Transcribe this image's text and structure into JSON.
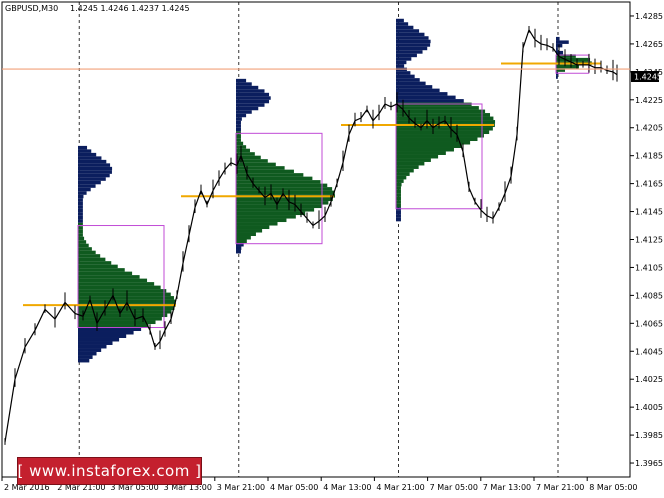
{
  "chart_data": {
    "type": "candlestick",
    "symbol_header": "GBPUSD,M30",
    "ohlc_header": "1.4245 1.4246 1.4237 1.4245",
    "current_price_label": "1.4245",
    "ylim": [
      1.3955,
      1.4295
    ],
    "y_ticks": [
      "1.4285",
      "1.4265",
      "1.4245",
      "1.4225",
      "1.4205",
      "1.4185",
      "1.4165",
      "1.4145",
      "1.4125",
      "1.4105",
      "1.4085",
      "1.4065",
      "1.4045",
      "1.4025",
      "1.4005",
      "1.3985",
      "1.3965"
    ],
    "x_ticks": [
      "2 Mar 2016",
      "2 Mar 21:00",
      "3 Mar 05:00",
      "3 Mar 13:00",
      "3 Mar 21:00",
      "4 Mar 05:00",
      "4 Mar 13:00",
      "4 Mar 21:00",
      "7 Mar 05:00",
      "7 Mar 13:00",
      "7 Mar 21:00",
      "8 Mar 05:00"
    ],
    "session_separators": [
      "2 Mar 21:00",
      "3 Mar 21:00",
      "4 Mar 21:00",
      "7 Mar 21:00"
    ],
    "horizontal_level": 1.4247,
    "price_path": [
      [
        0,
        1.398
      ],
      [
        10,
        1.4025
      ],
      [
        20,
        1.4048
      ],
      [
        30,
        1.406
      ],
      [
        40,
        1.4075
      ],
      [
        50,
        1.4068
      ],
      [
        60,
        1.408
      ],
      [
        70,
        1.4072
      ],
      [
        78,
        1.407
      ],
      [
        85,
        1.4082
      ],
      [
        92,
        1.4065
      ],
      [
        100,
        1.4075
      ],
      [
        108,
        1.4085
      ],
      [
        115,
        1.4072
      ],
      [
        122,
        1.408
      ],
      [
        130,
        1.4068
      ],
      [
        138,
        1.407
      ],
      [
        145,
        1.406
      ],
      [
        150,
        1.4048
      ],
      [
        155,
        1.4052
      ],
      [
        160,
        1.406
      ],
      [
        166,
        1.4068
      ],
      [
        172,
        1.4085
      ],
      [
        178,
        1.4108
      ],
      [
        184,
        1.4128
      ],
      [
        190,
        1.4148
      ],
      [
        196,
        1.416
      ],
      [
        202,
        1.415
      ],
      [
        208,
        1.416
      ],
      [
        214,
        1.4168
      ],
      [
        220,
        1.4175
      ],
      [
        226,
        1.418
      ],
      [
        232,
        1.4178
      ],
      [
        236,
        1.4185
      ],
      [
        242,
        1.4172
      ],
      [
        248,
        1.4165
      ],
      [
        254,
        1.416
      ],
      [
        260,
        1.4155
      ],
      [
        266,
        1.4158
      ],
      [
        272,
        1.415
      ],
      [
        278,
        1.4158
      ],
      [
        284,
        1.4152
      ],
      [
        290,
        1.415
      ],
      [
        296,
        1.4145
      ],
      [
        302,
        1.414
      ],
      [
        308,
        1.4135
      ],
      [
        314,
        1.4138
      ],
      [
        320,
        1.4142
      ],
      [
        326,
        1.4152
      ],
      [
        332,
        1.4165
      ],
      [
        338,
        1.418
      ],
      [
        344,
        1.42
      ],
      [
        350,
        1.421
      ],
      [
        356,
        1.4212
      ],
      [
        362,
        1.4218
      ],
      [
        368,
        1.421
      ],
      [
        374,
        1.4215
      ],
      [
        380,
        1.4222
      ],
      [
        386,
        1.422
      ],
      [
        392,
        1.4222
      ],
      [
        398,
        1.4218
      ],
      [
        404,
        1.4212
      ],
      [
        410,
        1.4208
      ],
      [
        416,
        1.4205
      ],
      [
        422,
        1.421
      ],
      [
        428,
        1.4205
      ],
      [
        434,
        1.4208
      ],
      [
        440,
        1.421
      ],
      [
        446,
        1.4204
      ],
      [
        452,
        1.42
      ],
      [
        458,
        1.4188
      ],
      [
        464,
        1.4162
      ],
      [
        470,
        1.4152
      ],
      [
        476,
        1.4146
      ],
      [
        482,
        1.4142
      ],
      [
        488,
        1.414
      ],
      [
        494,
        1.4148
      ],
      [
        500,
        1.4158
      ],
      [
        506,
        1.417
      ],
      [
        512,
        1.42
      ],
      [
        518,
        1.4262
      ],
      [
        524,
        1.4275
      ],
      [
        530,
        1.4268
      ],
      [
        536,
        1.4265
      ],
      [
        542,
        1.4264
      ],
      [
        548,
        1.4262
      ],
      [
        554,
        1.4256
      ],
      [
        560,
        1.4254
      ],
      [
        566,
        1.4252
      ],
      [
        572,
        1.425
      ],
      [
        578,
        1.425
      ],
      [
        584,
        1.425
      ],
      [
        590,
        1.4248
      ],
      [
        596,
        1.4248
      ],
      [
        602,
        1.4246
      ],
      [
        608,
        1.4245
      ],
      [
        612,
        1.4243
      ]
    ],
    "session_profiles": [
      {
        "x_start": 78,
        "x_end": 236,
        "high": 1.4192,
        "low": 1.4037,
        "vah": 1.4135,
        "val": 1.4062,
        "poc": 1.4078
      },
      {
        "x_start": 236,
        "x_end": 396,
        "high": 1.424,
        "low": 1.4115,
        "vah": 1.4201,
        "val": 1.4122,
        "poc": 1.4156
      },
      {
        "x_start": 396,
        "x_end": 556,
        "high": 1.4282,
        "low": 1.4138,
        "vah": 1.4222,
        "val": 1.4147,
        "poc": 1.4207
      },
      {
        "x_start": 556,
        "x_end": 616,
        "high": 1.4268,
        "low": 1.424,
        "vah": 1.4257,
        "val": 1.4244,
        "poc": 1.4251
      }
    ]
  },
  "watermark": {
    "text": "[ www.instaforex.com ]",
    "bg_color": "#c4202e",
    "text_color": "#ffffff"
  },
  "colors": {
    "price_line": "#000000",
    "profile_dark": "#0b1e5e",
    "profile_green": "#0f5a1f",
    "value_area_box": "#c04bd6",
    "poc_line": "#f0a800",
    "level_line": "#f2a07a",
    "price_tag_bg": "#000000"
  }
}
